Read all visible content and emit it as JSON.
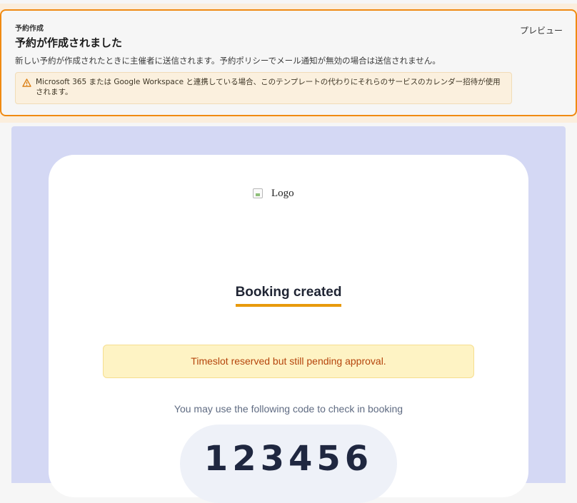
{
  "header": {
    "eyebrow": "予約作成",
    "title": "予約が作成されました",
    "description": "新しい予約が作成されたときに主催者に送信されます。予約ポリシーでメール通知が無効の場合は送信されません。",
    "preview_label": "プレビュー",
    "warning": "Microsoft 365 または Google Workspace と連携している場合、このテンプレートの代わりにそれらのサービスのカレンダー招待が使用されます。"
  },
  "email": {
    "logo_alt": "Logo",
    "heading": "Booking created",
    "pending_notice": "Timeslot reserved but still pending approval.",
    "checkin_text": "You may use the following code to check in booking",
    "code": "123456"
  },
  "colors": {
    "accent": "#f08a12",
    "preview_bg": "#d4d8f4",
    "heading_underline": "#e89a0c",
    "pending_text": "#b5450c"
  },
  "icons": {
    "warning": "warning-triangle-icon",
    "logo": "broken-image-icon"
  }
}
